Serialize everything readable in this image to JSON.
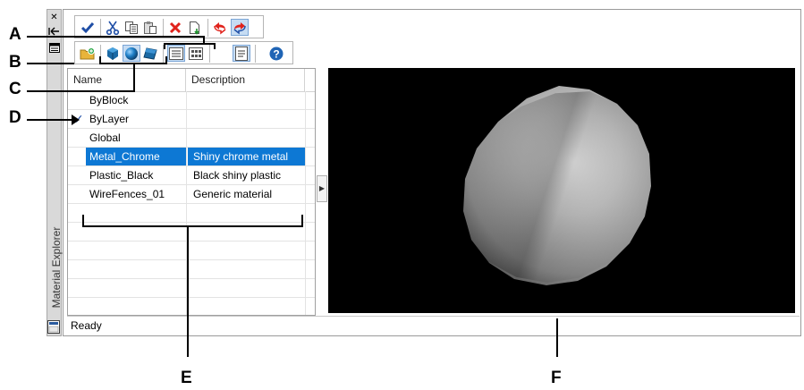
{
  "palette": {
    "title": "Material Explorer",
    "strip_buttons": [
      "close-icon",
      "auto-hide-icon",
      "properties-icon"
    ]
  },
  "toolbar_top": {
    "buttons": [
      "apply-check-icon",
      "cut-icon",
      "copy-icon",
      "paste-icon",
      "delete-icon",
      "new-material-icon",
      "undo-icon",
      "redo-icon"
    ]
  },
  "toolbar_second": {
    "buttons": [
      "folder-icon",
      "cube-icon",
      "sphere-icon",
      "plane-icon",
      "list-view-icon",
      "thumbnail-view-icon",
      "details-icon",
      "help-icon"
    ]
  },
  "table": {
    "columns": [
      "Name",
      "Description"
    ],
    "rows": [
      {
        "name": "ByBlock",
        "description": ""
      },
      {
        "name": "ByLayer",
        "description": "",
        "checked": true
      },
      {
        "name": "Global",
        "description": ""
      },
      {
        "name": "Metal_Chrome",
        "description": "Shiny chrome metal",
        "selected": true
      },
      {
        "name": "Plastic_Black",
        "description": "Black shiny plastic"
      },
      {
        "name": "WireFences_01",
        "description": "Generic material"
      }
    ]
  },
  "status": {
    "text": "Ready"
  },
  "callouts": {
    "a": "A",
    "b": "B",
    "c": "C",
    "d": "D",
    "e": "E",
    "f": "F"
  },
  "colors": {
    "selection": "#0d78d4",
    "preview_bg": "#000000",
    "check": "#1f4ea6"
  }
}
